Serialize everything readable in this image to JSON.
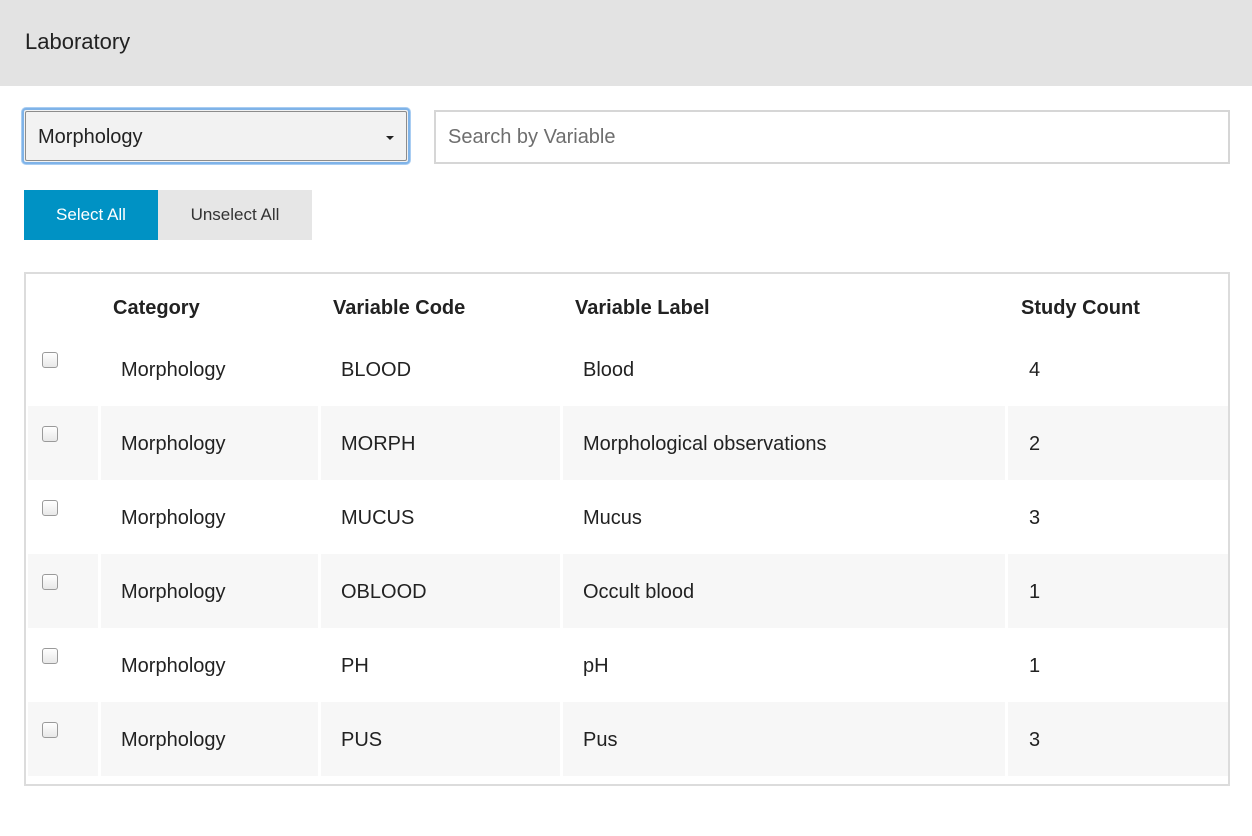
{
  "header": {
    "title": "Laboratory"
  },
  "filters": {
    "category_select": {
      "selected": "Morphology"
    },
    "search": {
      "placeholder": "Search by Variable",
      "value": ""
    }
  },
  "actions": {
    "select_all_label": "Select All",
    "unselect_all_label": "Unselect All"
  },
  "table": {
    "columns": [
      "Category",
      "Variable Code",
      "Variable Label",
      "Study Count"
    ],
    "rows": [
      {
        "category": "Morphology",
        "code": "BLOOD",
        "label": "Blood",
        "count": "4",
        "checked": false
      },
      {
        "category": "Morphology",
        "code": "MORPH",
        "label": "Morphological observations",
        "count": "2",
        "checked": false
      },
      {
        "category": "Morphology",
        "code": "MUCUS",
        "label": "Mucus",
        "count": "3",
        "checked": false
      },
      {
        "category": "Morphology",
        "code": "OBLOOD",
        "label": "Occult blood",
        "count": "1",
        "checked": false
      },
      {
        "category": "Morphology",
        "code": "PH",
        "label": "pH",
        "count": "1",
        "checked": false
      },
      {
        "category": "Morphology",
        "code": "PUS",
        "label": "Pus",
        "count": "3",
        "checked": false
      }
    ]
  },
  "colors": {
    "header_bg": "#e3e3e3",
    "primary_button": "#0092c4",
    "secondary_button": "#e6e6e6",
    "row_stripe": "#f7f7f7",
    "focus_ring": "#7fb3e8"
  }
}
